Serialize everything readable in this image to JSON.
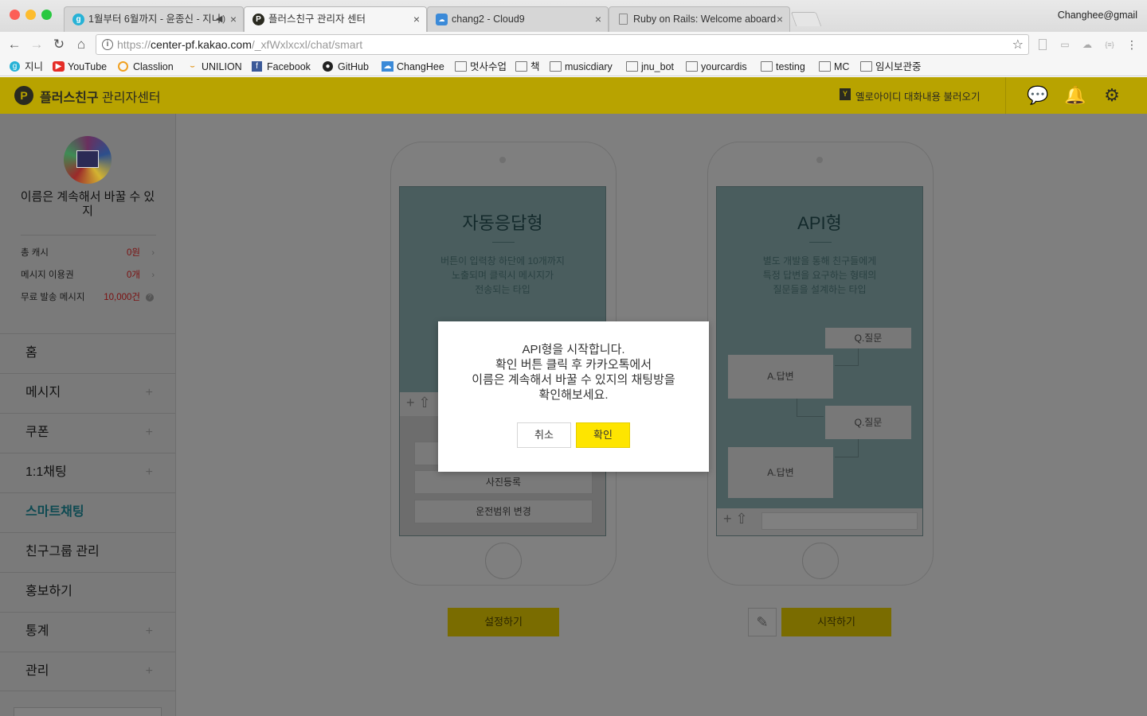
{
  "browser": {
    "tabs": [
      {
        "title": "1월부터 6월까지 - 윤종신 - 지니",
        "icon": "g",
        "icon_color": "#27b2d6"
      },
      {
        "title": "플러스친구 관리자 센터",
        "icon": "P",
        "icon_color": "#2a2a20"
      },
      {
        "title": "chang2 - Cloud9",
        "icon": "c9",
        "icon_color": "#3b8ad8"
      },
      {
        "title": "Ruby on Rails: Welcome aboard",
        "icon": "doc",
        "icon_color": "#888888"
      }
    ],
    "user": "Changhee@gmail",
    "url_scheme": "https://",
    "url_host": "center-pf.kakao.com",
    "url_path": "/_xfWxlxcxl/chat/smart",
    "bookmarks": [
      "지니",
      "YouTube",
      "Classlion",
      "UNILION",
      "Facebook",
      "GitHub",
      "ChangHee",
      "멋사수업",
      "책",
      "musicdiary",
      "jnu_bot",
      "yourcardis",
      "testing",
      "MC",
      "임시보관중"
    ]
  },
  "header": {
    "logo_letter": "P",
    "title_bold": "플러스친구",
    "title_light": " 관리자센터",
    "yellowid_icon": "Y",
    "yellowid_label": "옐로아이디 대화내용 불러오기"
  },
  "sidebar": {
    "profile_name": "이름은 계속해서 바꿀 수 있지",
    "stats": [
      {
        "label": "총 캐시",
        "value": "0원"
      },
      {
        "label": "메시지 이용권",
        "value": "0개"
      },
      {
        "label": "무료 발송 메시지",
        "value": "10,000건"
      }
    ],
    "menu": [
      "홈",
      "메시지",
      "쿠폰",
      "1:1채팅",
      "스마트채팅",
      "친구그룹 관리",
      "홍보하기",
      "통계",
      "관리"
    ],
    "plus_symbol": "+"
  },
  "main": {
    "auto": {
      "title": "자동응답형",
      "desc": [
        "버튼이 입력창 하단에 10개까지",
        "노출되며 클릭시 메시지가",
        "전송되는 타입"
      ],
      "options": [
        "사진등록",
        "운전범위 변경"
      ],
      "button": "설정하기"
    },
    "api": {
      "title": "API형",
      "desc": [
        "별도 개발을 통해 친구들에게",
        "특정 답변을 요구하는 형태의",
        "질문들을 설계하는 타입"
      ],
      "question": "Q.질문",
      "answer": "A.답변",
      "button": "시작하기"
    }
  },
  "modal": {
    "lines": [
      "API형을 시작합니다.",
      "확인 버튼 클릭 후 카카오톡에서",
      "이름은 계속해서 바꿀 수 있지의 채팅방을",
      "확인해보세요."
    ],
    "cancel": "취소",
    "confirm": "확인"
  },
  "colors": {
    "kakao_yellow": "#fee500",
    "active_menu": "#0e4a52"
  }
}
